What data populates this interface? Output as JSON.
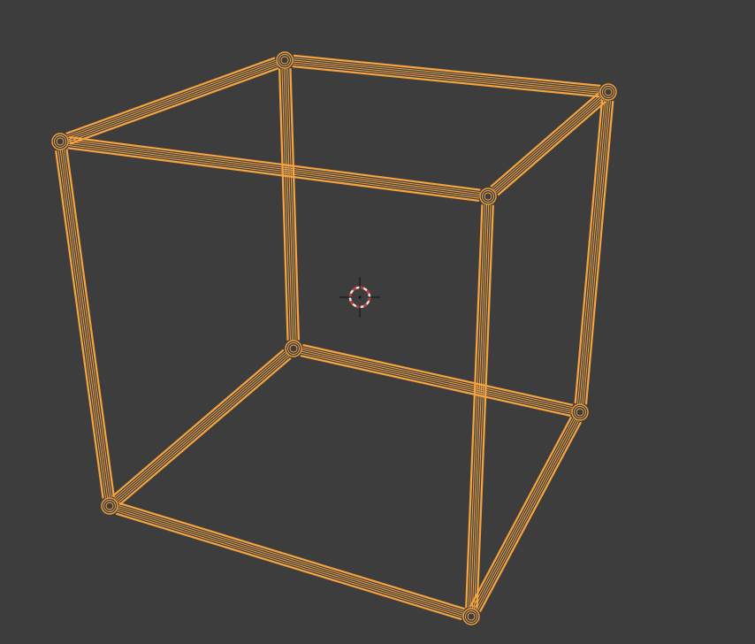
{
  "viewport": {
    "background": "#3d3d3d",
    "shading_mode": "wireframe"
  },
  "object": {
    "type": "cube",
    "modifier": "bevel",
    "selected": true,
    "outline_color": "#f2a13c",
    "wire_color": "#ffaa44"
  },
  "cursor_3d": {
    "icon": "3d-cursor-icon",
    "ring_color_a": "#e8e8e8",
    "ring_color_b": "#d03030",
    "crosshair_color": "#111111"
  }
}
